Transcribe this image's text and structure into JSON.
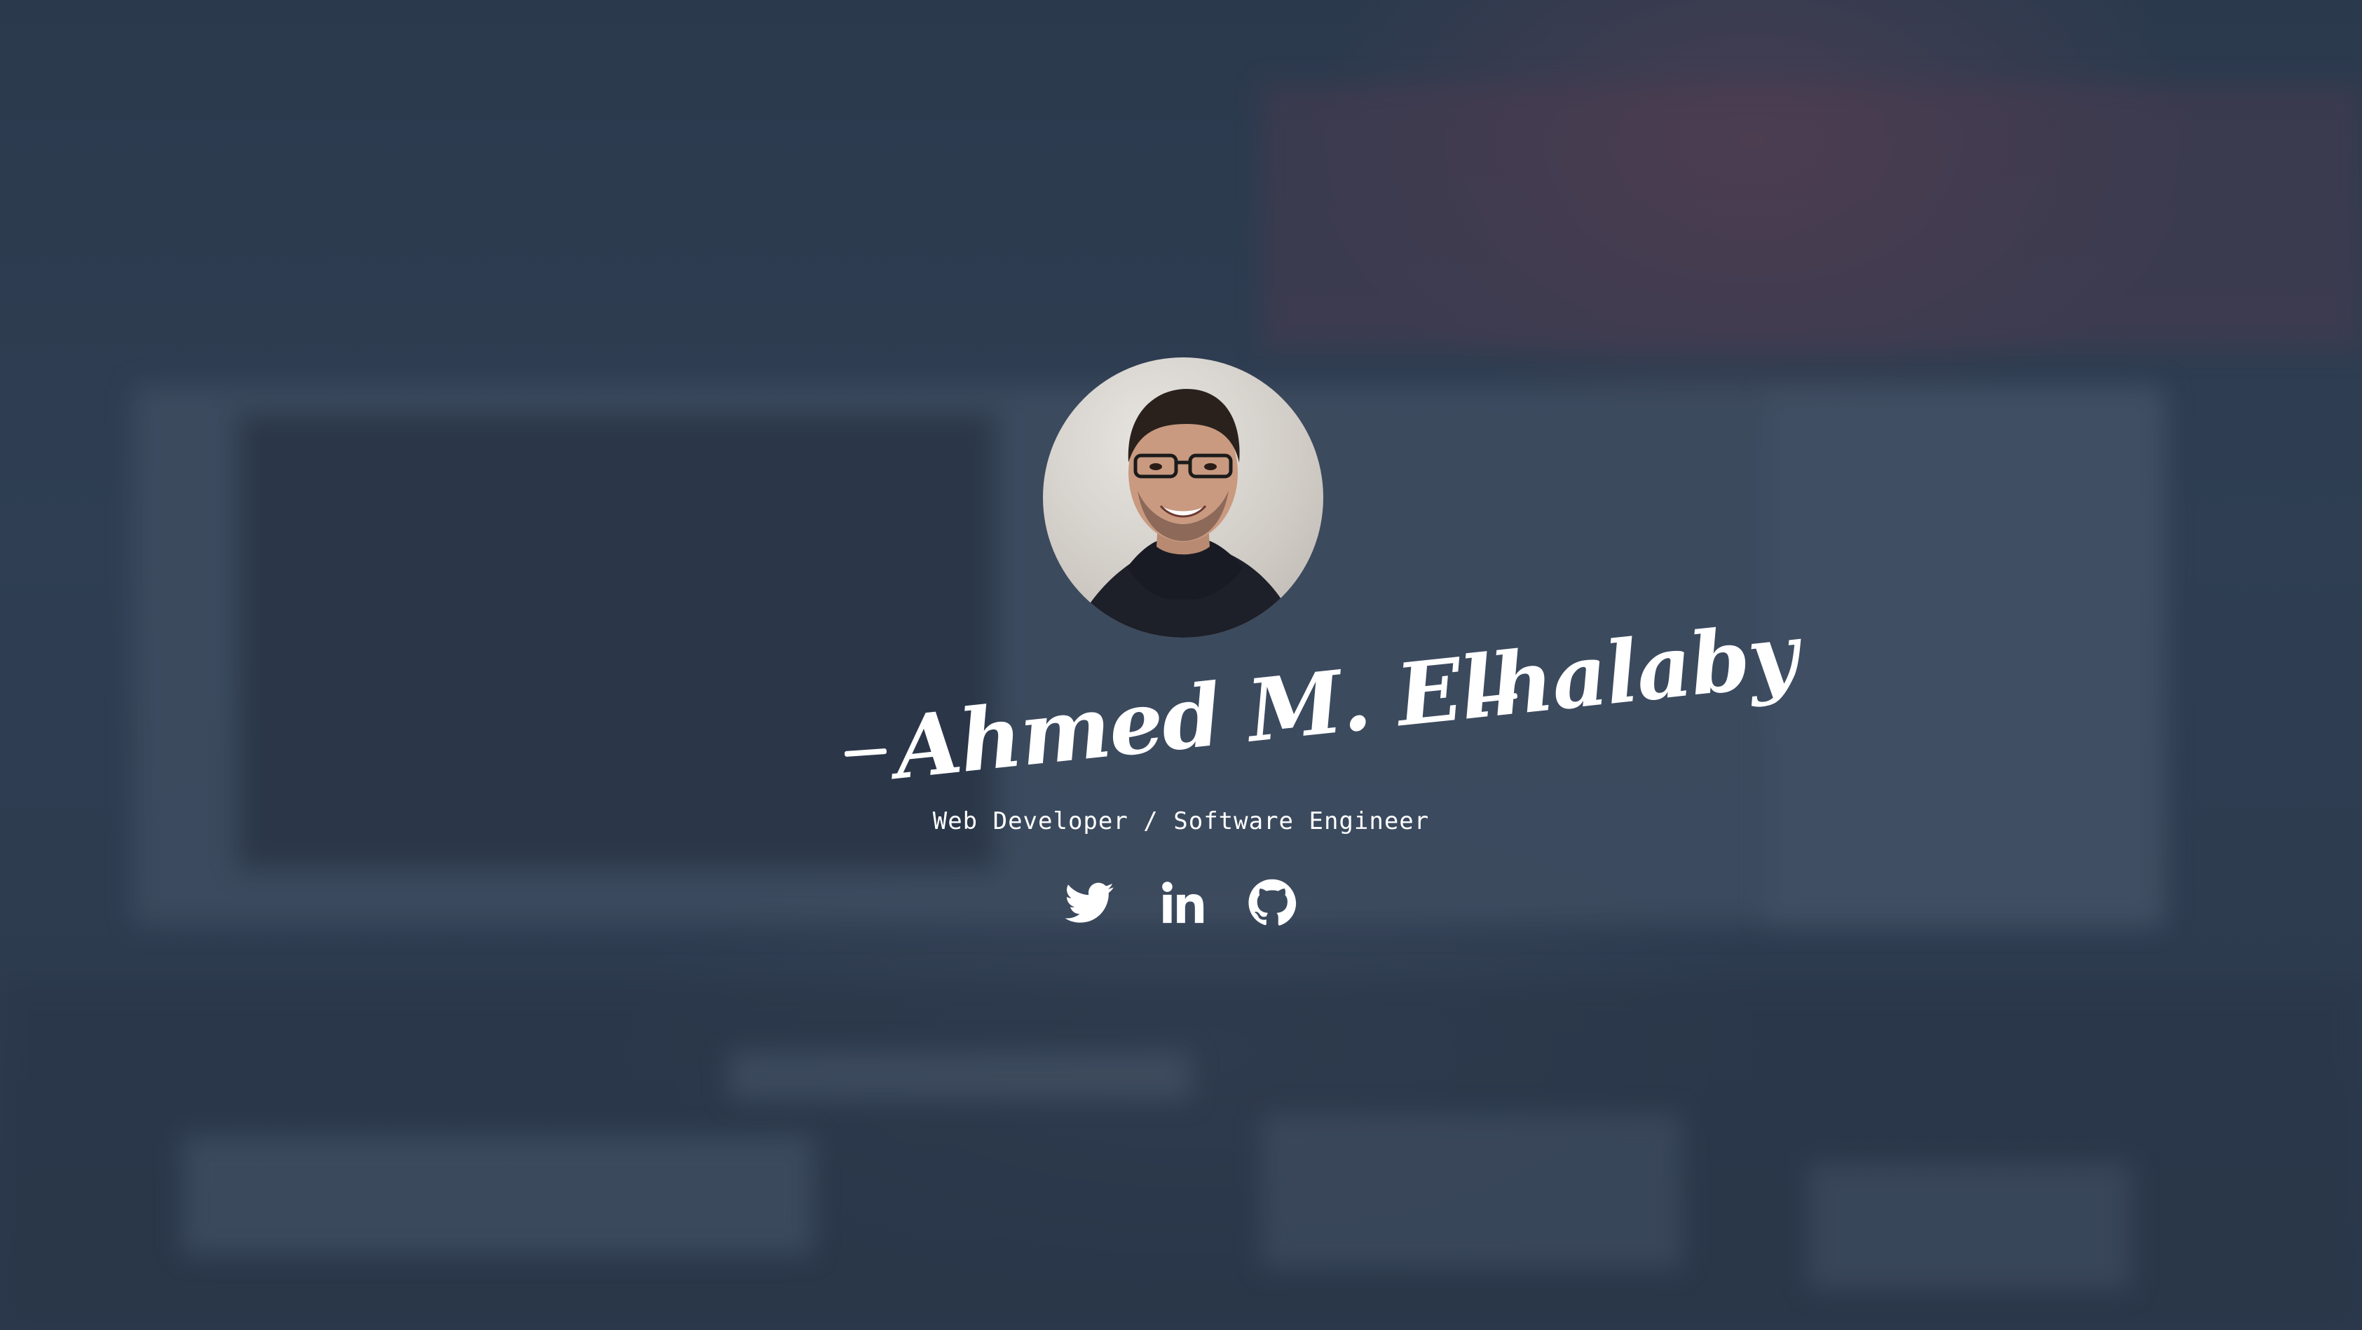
{
  "profile": {
    "name": "Ahmed M. Elhalaby",
    "subtitle": "Web Developer / Software Engineer",
    "avatar_alt": "Ahmed M. Elhalaby"
  },
  "social": [
    {
      "icon": "twitter-icon",
      "label": "Twitter"
    },
    {
      "icon": "linkedin-icon",
      "label": "LinkedIn"
    },
    {
      "icon": "github-icon",
      "label": "GitHub"
    }
  ],
  "colors": {
    "background": "#2f3c50",
    "text": "#ffffff"
  }
}
